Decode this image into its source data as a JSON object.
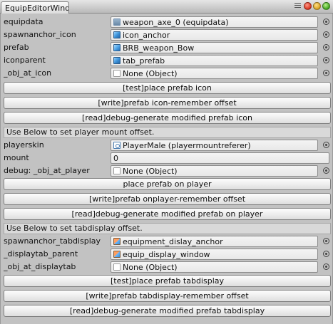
{
  "window": {
    "tab_title": "EquipEditorWind",
    "controls": [
      "close",
      "minimize",
      "maximize"
    ]
  },
  "section1": {
    "fields": [
      {
        "label": "equipdata",
        "value": "weapon_axe_0 (equipdata)",
        "icon": "script-icon"
      },
      {
        "label": "spawnanchor_icon",
        "value": "icon_anchor",
        "icon": "gameobject-icon"
      },
      {
        "label": "prefab",
        "value": "BRB_weapon_Bow",
        "icon": "prefab-icon"
      },
      {
        "label": "iconparent",
        "value": "tab_prefab",
        "icon": "gameobject-icon"
      },
      {
        "label": "_obj_at_icon",
        "value": "None (Object)",
        "icon": "none-object-icon"
      }
    ],
    "buttons": [
      "[test]place prefab icon",
      "[write]prefab icon-remember offset",
      "[read]debug-generate modified prefab icon"
    ]
  },
  "section2": {
    "help": "Use Below to set player mount offset.",
    "fields": [
      {
        "label": "playerskin",
        "value": "PlayerMale (playermountreferer)",
        "icon": "component-icon"
      },
      {
        "label": "mount",
        "value": "0"
      },
      {
        "label": "debug: _obj_at_player",
        "value": "None (Object)",
        "icon": "none-object-icon"
      }
    ],
    "buttons": [
      "place prefab on player",
      "[write]prefab onplayer-remember offset",
      "[read]debug-generate modified prefab on player"
    ]
  },
  "section3": {
    "help": "Use Below to set tabdisplay offset.",
    "fields": [
      {
        "label": "spawnanchor_tabdisplay",
        "value": "equipment_dislay_anchor",
        "icon": "anchor-gameobject-icon"
      },
      {
        "label": "_displaytab_parent",
        "value": "equip_display_window",
        "icon": "anchor-gameobject-icon"
      },
      {
        "label": "_obj_at_displaytab",
        "value": "None (Object)",
        "icon": "none-object-icon"
      }
    ],
    "buttons": [
      "[test]place prefab tabdisplay",
      "[write]prefab tabdisplay-remember offset",
      "[read]debug-generate modified prefab tabdisplay"
    ]
  }
}
